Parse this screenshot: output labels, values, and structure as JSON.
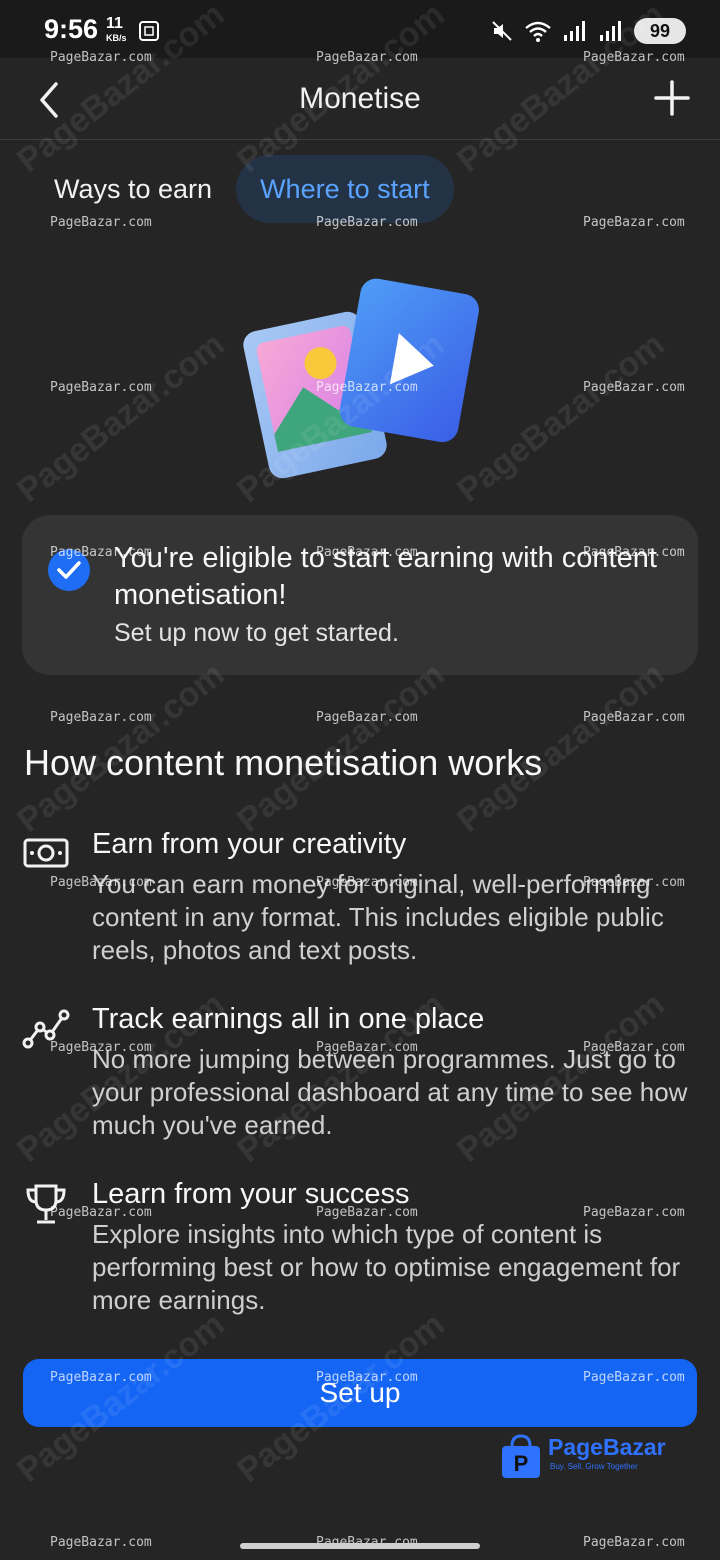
{
  "status_bar": {
    "time": "9:56",
    "speed_value": "11",
    "speed_unit": "KB/s",
    "battery": "99"
  },
  "header": {
    "title": "Monetise"
  },
  "tabs": [
    {
      "label": "Ways to earn",
      "selected": false
    },
    {
      "label": "Where to start",
      "selected": true
    }
  ],
  "eligibility": {
    "title": "You're eligible to start earning with content monetisation!",
    "subtitle": "Set up now to get started."
  },
  "how_it_works": {
    "title": "How content monetisation works",
    "features": [
      {
        "icon": "money-icon",
        "title": "Earn from your creativity",
        "description": "You can earn money for original, well-performing content in any format. This includes eligible public reels, photos and text posts."
      },
      {
        "icon": "trend-chart-icon",
        "title": "Track earnings all in one place",
        "description": "No more jumping between programmes. Just go to your professional dashboard at any time to see how much you've earned."
      },
      {
        "icon": "trophy-icon",
        "title": "Learn from your success",
        "description": "Explore insights into which type of content is performing best or how to optimise engagement for more earnings."
      }
    ]
  },
  "primary_action": {
    "label": "Set up"
  },
  "watermark": {
    "text": "PageBazar.com",
    "brand_name": "PageBazar",
    "brand_tagline": "Buy. Sell. Grow Together"
  },
  "colors": {
    "background": "#252525",
    "accent": "#1565f5",
    "tab_selected_text": "#5aa3ff"
  }
}
